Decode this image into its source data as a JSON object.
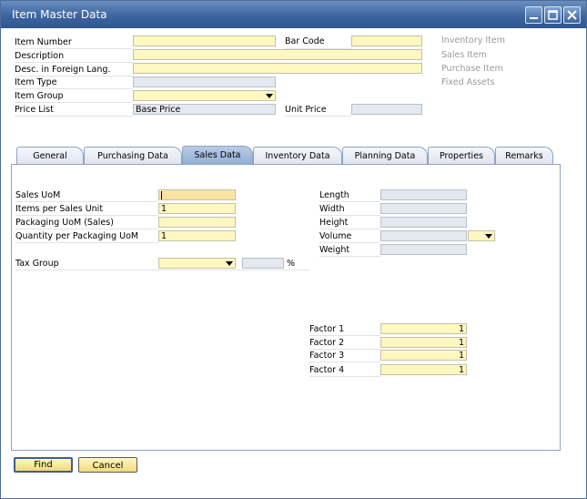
{
  "window": {
    "title": "Item Master Data"
  },
  "header": {
    "item_number": {
      "label": "Item Number",
      "value": ""
    },
    "bar_code": {
      "label": "Bar Code",
      "value": ""
    },
    "description": {
      "label": "Description",
      "value": ""
    },
    "foreign_desc": {
      "label": "Desc. in Foreign Lang.",
      "value": ""
    },
    "item_type": {
      "label": "Item Type",
      "value": ""
    },
    "item_group": {
      "label": "Item Group",
      "value": ""
    },
    "price_list": {
      "label": "Price List",
      "value": "Base Price"
    },
    "unit_price": {
      "label": "Unit Price",
      "value": ""
    }
  },
  "side_options": [
    "Inventory Item",
    "Sales Item",
    "Purchase Item",
    "Fixed Assets"
  ],
  "tabs": [
    "General",
    "Purchasing Data",
    "Sales Data",
    "Inventory Data",
    "Planning Data",
    "Properties",
    "Remarks"
  ],
  "active_tab": "Sales Data",
  "sales": {
    "sales_uom": {
      "label": "Sales UoM",
      "value": ""
    },
    "items_per_unit": {
      "label": "Items per Sales Unit",
      "value": "1"
    },
    "packaging_uom": {
      "label": "Packaging UoM (Sales)",
      "value": ""
    },
    "qty_per_packaging": {
      "label": "Quantity per Packaging UoM",
      "value": "1"
    },
    "tax_group": {
      "label": "Tax Group",
      "value": "",
      "percent_value": "",
      "percent_sign": "%"
    },
    "length": {
      "label": "Length",
      "value": ""
    },
    "width": {
      "label": "Width",
      "value": ""
    },
    "height": {
      "label": "Height",
      "value": ""
    },
    "volume": {
      "label": "Volume",
      "value": ""
    },
    "weight": {
      "label": "Weight",
      "value": ""
    },
    "factors": [
      {
        "label": "Factor 1",
        "value": "1"
      },
      {
        "label": "Factor 2",
        "value": "1"
      },
      {
        "label": "Factor 3",
        "value": "1"
      },
      {
        "label": "Factor 4",
        "value": "1"
      }
    ]
  },
  "buttons": {
    "find": "Find",
    "cancel": "Cancel"
  },
  "colors": {
    "title_bar": "#3c659f",
    "field_yellow": "#fff7c0",
    "field_gray": "#e4e8ef",
    "active_tab": "#93b0d6",
    "button": "#f3d97a"
  }
}
